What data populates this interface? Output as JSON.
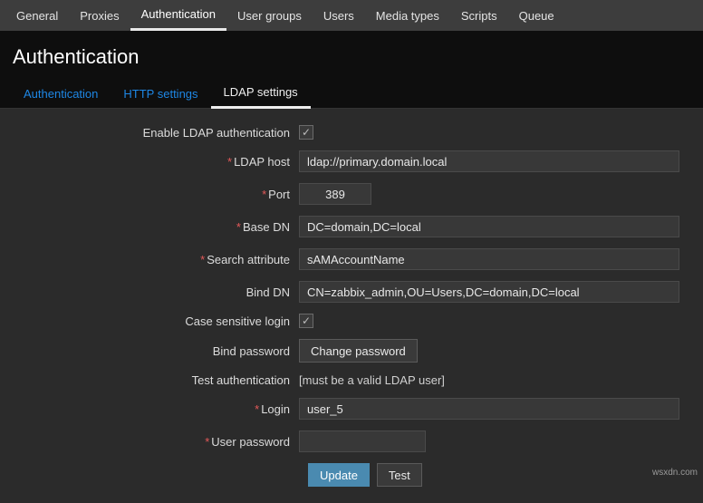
{
  "topnav": {
    "items": [
      {
        "label": "General"
      },
      {
        "label": "Proxies"
      },
      {
        "label": "Authentication"
      },
      {
        "label": "User groups"
      },
      {
        "label": "Users"
      },
      {
        "label": "Media types"
      },
      {
        "label": "Scripts"
      },
      {
        "label": "Queue"
      }
    ],
    "active_index": 2
  },
  "page": {
    "title": "Authentication"
  },
  "subtabs": {
    "items": [
      {
        "label": "Authentication"
      },
      {
        "label": "HTTP settings"
      },
      {
        "label": "LDAP settings"
      }
    ],
    "active_index": 2
  },
  "form": {
    "enable_ldap": {
      "label": "Enable LDAP authentication",
      "checked": true
    },
    "ldap_host": {
      "label": "LDAP host",
      "required": true,
      "value": "ldap://primary.domain.local"
    },
    "port": {
      "label": "Port",
      "required": true,
      "value": "389"
    },
    "base_dn": {
      "label": "Base DN",
      "required": true,
      "value": "DC=domain,DC=local"
    },
    "search_attr": {
      "label": "Search attribute",
      "required": true,
      "value": "sAMAccountName"
    },
    "bind_dn": {
      "label": "Bind DN",
      "value": "CN=zabbix_admin,OU=Users,DC=domain,DC=local"
    },
    "case_sens": {
      "label": "Case sensitive login",
      "checked": true
    },
    "bind_pw": {
      "label": "Bind password",
      "button": "Change password"
    },
    "test_auth": {
      "label": "Test authentication",
      "text": "[must be a valid LDAP user]"
    },
    "login": {
      "label": "Login",
      "required": true,
      "value": "user_5"
    },
    "user_pw": {
      "label": "User password",
      "required": true,
      "value": ""
    }
  },
  "buttons": {
    "update": "Update",
    "test": "Test"
  },
  "watermark": "wsxdn.com"
}
